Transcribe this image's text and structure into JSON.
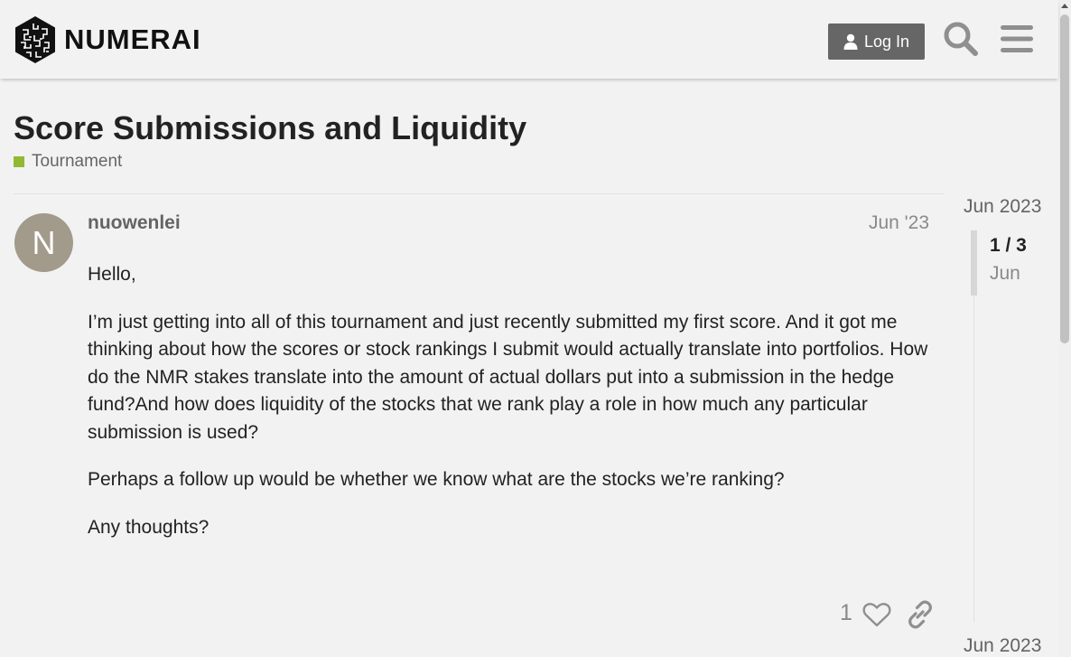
{
  "header": {
    "brand": "NUMERAI",
    "login_label": "Log In"
  },
  "topic": {
    "title": "Score Submissions and Liquidity",
    "category": "Tournament",
    "category_color": "#92b934"
  },
  "post": {
    "avatar_letter": "N",
    "avatar_color": "#a29a8b",
    "username": "nuowenlei",
    "date": "Jun '23",
    "paragraphs": [
      "Hello,",
      "I’m just getting into all of this tournament and just recently submitted my first score. And it got me thinking about how the scores or stock rankings I submit would actually translate into portfolios. How do the NMR stakes translate into the amount of actual dollars put into a submission in the hedge fund?And how does liquidity of the stocks that we rank play a role in how much any particular submission is used?",
      "Perhaps a follow up would be whether we know what are the stocks we’re ranking?",
      "Any thoughts?"
    ],
    "like_count": "1"
  },
  "timeline": {
    "start_date": "Jun 2023",
    "position": "1 / 3",
    "current_month": "Jun",
    "end_date": "Jun 2023"
  },
  "icons": {
    "login": "user-icon",
    "search": "search-icon",
    "menu": "hamburger-menu-icon",
    "like": "heart-icon",
    "share": "link-icon"
  }
}
